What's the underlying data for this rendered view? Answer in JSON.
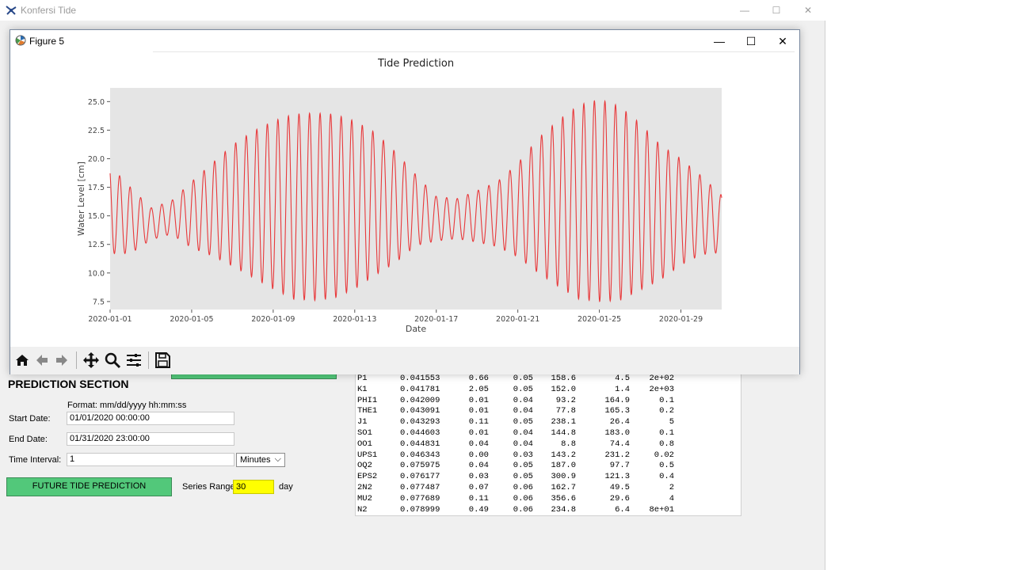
{
  "app": {
    "title": "Konfersi Tide",
    "minimize": "—",
    "maximize": "☐",
    "close": "✕"
  },
  "figure": {
    "title": "Figure 5",
    "minimize": "—",
    "maximize": "☐",
    "close": "✕"
  },
  "prediction": {
    "section_title": "PREDICTION SECTION",
    "format_hint": "Format: mm/dd/yyyy hh:mm:ss",
    "start_label": "Start Date:",
    "start_value": "01/01/2020 00:00:00",
    "end_label": "End Date:",
    "end_value": "01/31/2020 23:00:00",
    "interval_label": "Time Interval:",
    "interval_value": "1",
    "interval_unit": "Minutes",
    "predict_button": "FUTURE TIDE PREDICTION",
    "series_label": "Series Range:",
    "series_value": "30",
    "series_unit": "day"
  },
  "constituents": [
    [
      "P1",
      "0.041553",
      "0.66",
      "0.05",
      "158.6",
      "4.5",
      "2e+02"
    ],
    [
      "K1",
      "0.041781",
      "2.05",
      "0.05",
      "152.0",
      "1.4",
      "2e+03"
    ],
    [
      "PHI1",
      "0.042009",
      "0.01",
      "0.04",
      "93.2",
      "164.9",
      "0.1"
    ],
    [
      "THE1",
      "0.043091",
      "0.01",
      "0.04",
      "77.8",
      "165.3",
      "0.2"
    ],
    [
      "J1",
      "0.043293",
      "0.11",
      "0.05",
      "238.1",
      "26.4",
      "5"
    ],
    [
      "SO1",
      "0.044603",
      "0.01",
      "0.04",
      "144.8",
      "183.0",
      "0.1"
    ],
    [
      "OO1",
      "0.044831",
      "0.04",
      "0.04",
      "8.8",
      "74.4",
      "0.8"
    ],
    [
      "UPS1",
      "0.046343",
      "0.00",
      "0.03",
      "143.2",
      "231.2",
      "0.02"
    ],
    [
      "OQ2",
      "0.075975",
      "0.04",
      "0.05",
      "187.0",
      "97.7",
      "0.5"
    ],
    [
      "EPS2",
      "0.076177",
      "0.03",
      "0.05",
      "300.9",
      "121.3",
      "0.4"
    ],
    [
      "2N2",
      "0.077487",
      "0.07",
      "0.06",
      "162.7",
      "49.5",
      "2"
    ],
    [
      "MU2",
      "0.077689",
      "0.11",
      "0.06",
      "356.6",
      "29.6",
      "4"
    ],
    [
      "N2",
      "0.078999",
      "0.49",
      "0.06",
      "234.8",
      "6.4",
      "8e+01"
    ]
  ],
  "toolbar": [
    "home-icon",
    "back-arrow-icon",
    "forward-arrow-icon",
    "pan-icon",
    "zoom-icon",
    "configure-subplots-icon",
    "save-icon"
  ],
  "chart_data": {
    "type": "line",
    "title": "Tide Prediction",
    "xlabel": "Date",
    "ylabel": "Water Level [cm]",
    "xticks": [
      "2020-01-01",
      "2020-01-05",
      "2020-01-09",
      "2020-01-13",
      "2020-01-17",
      "2020-01-21",
      "2020-01-25",
      "2020-01-29"
    ],
    "yticks": [
      "7.5",
      "10.0",
      "12.5",
      "15.0",
      "17.5",
      "20.0",
      "22.5",
      "25.0"
    ],
    "xlim": [
      "2020-01-01",
      "2020-01-31"
    ],
    "ylim": [
      6.8,
      26.2
    ],
    "grid": false,
    "background": "#e5e5e5",
    "line_color": "#e8383a",
    "series": [
      {
        "x": [
          "2020-01-01",
          "2020-01-02",
          "2020-01-03",
          "2020-01-04",
          "2020-01-05",
          "2020-01-06",
          "2020-01-07",
          "2020-01-08",
          "2020-01-09",
          "2020-01-10",
          "2020-01-11",
          "2020-01-12",
          "2020-01-13",
          "2020-01-14",
          "2020-01-15",
          "2020-01-16",
          "2020-01-17",
          "2020-01-18",
          "2020-01-19",
          "2020-01-20",
          "2020-01-21",
          "2020-01-22",
          "2020-01-23",
          "2020-01-24",
          "2020-01-25",
          "2020-01-26",
          "2020-01-27",
          "2020-01-28",
          "2020-01-29",
          "2020-01-30",
          "2020-01-31"
        ],
        "high": [
          19.4,
          17.5,
          15.7,
          16.3,
          18.0,
          19.6,
          21.2,
          22.4,
          23.3,
          23.9,
          24.0,
          23.9,
          23.3,
          22.3,
          20.6,
          18.6,
          16.7,
          16.5,
          17.2,
          18.0,
          19.6,
          21.8,
          23.4,
          24.7,
          25.2,
          24.6,
          23.1,
          21.2,
          20.0,
          18.5,
          16.8
        ],
        "low": [
          11.7,
          11.7,
          12.9,
          13.4,
          12.2,
          11.5,
          10.6,
          9.6,
          8.6,
          7.7,
          7.6,
          7.8,
          8.6,
          9.8,
          10.9,
          12.4,
          12.8,
          13.0,
          12.7,
          12.3,
          11.4,
          10.0,
          8.8,
          7.7,
          7.5,
          7.6,
          8.5,
          9.4,
          10.7,
          11.6,
          11.8
        ]
      }
    ]
  }
}
